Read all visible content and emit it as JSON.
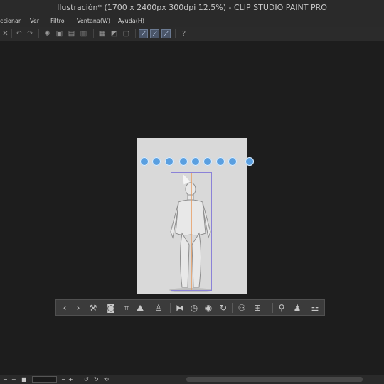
{
  "window": {
    "title": "Ilustración* (1700 x 2400px 300dpi 12.5%)  - CLIP STUDIO PAINT PRO"
  },
  "menu": {
    "items": [
      {
        "label": "ccionar"
      },
      {
        "label": "Ver"
      },
      {
        "label": "Filtro"
      },
      {
        "label": "Ventana(W)"
      },
      {
        "label": "Ayuda(H)"
      }
    ]
  },
  "command_bar": {
    "icons": [
      "close-icon",
      "undo-icon",
      "redo-icon",
      "spinner-icon",
      "copy-icon",
      "clear-icon",
      "bucket-icon",
      "grid-icon",
      "ruler-icon",
      "square-icon",
      "pen-stab-1-icon",
      "pen-stab-2-icon",
      "pen-stab-3-icon",
      "help-icon"
    ]
  },
  "canvas_tools": {
    "icons": [
      "camera-rotate-icon",
      "move-icon",
      "flatten-icon",
      "pan-icon",
      "rotate-icon",
      "roll-icon",
      "tilt-icon",
      "scale-icon",
      "reset-icon"
    ]
  },
  "object_launcher": {
    "icons": [
      "prev-icon",
      "next-icon",
      "wrench-icon",
      "camera-icon",
      "fit-icon",
      "mountain-3d-icon",
      "pose-icon",
      "flip-icon",
      "clock-icon",
      "capture-icon",
      "sync-icon",
      "person-add-icon",
      "frame-icon",
      "lock-icon",
      "body-icon"
    ]
  },
  "status": {
    "zoom_value": ""
  }
}
